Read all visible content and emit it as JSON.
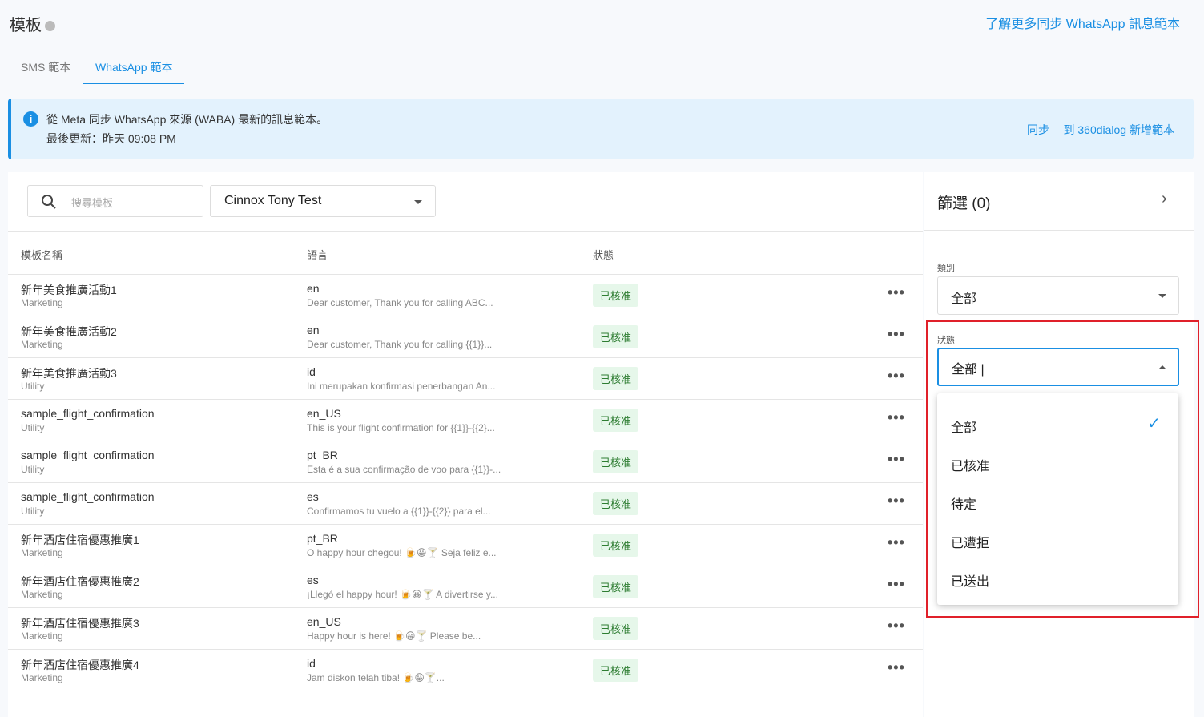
{
  "header": {
    "title": "模板",
    "learn_more": "了解更多同步 WhatsApp 訊息範本"
  },
  "tabs": [
    {
      "label": "SMS 範本"
    },
    {
      "label": "WhatsApp 範本"
    }
  ],
  "banner": {
    "line1": "從 Meta 同步 WhatsApp 來源 (WABA) 最新的訊息範本。",
    "line2": "最後更新：昨天 09:08 PM",
    "sync": "同步",
    "add": "到 360dialog 新增範本"
  },
  "search": {
    "placeholder": "搜尋模板"
  },
  "account_select": {
    "value": "Cinnox Tony Test"
  },
  "table": {
    "headers": [
      "模板名稱",
      "語言",
      "狀態"
    ],
    "rows": [
      {
        "name": "新年美食推廣活動1",
        "category": "Marketing",
        "lang": "en",
        "preview": "Dear customer, Thank you for calling ABC...",
        "status": "已核准"
      },
      {
        "name": "新年美食推廣活動2",
        "category": "Marketing",
        "lang": "en",
        "preview": "Dear customer, Thank you for calling {{1}}...",
        "status": "已核准"
      },
      {
        "name": "新年美食推廣活動3",
        "category": "Utility",
        "lang": "id",
        "preview": "Ini merupakan konfirmasi penerbangan An...",
        "status": "已核准"
      },
      {
        "name": "sample_flight_confirmation",
        "category": "Utility",
        "lang": "en_US",
        "preview": "This is your flight confirmation for {{1}}-{{2}...",
        "status": "已核准"
      },
      {
        "name": "sample_flight_confirmation",
        "category": "Utility",
        "lang": "pt_BR",
        "preview": "Esta é a sua confirmação de voo para {{1}}-...",
        "status": "已核准"
      },
      {
        "name": "sample_flight_confirmation",
        "category": "Utility",
        "lang": "es",
        "preview": "Confirmamos tu vuelo a {{1}}-{{2}} para el...",
        "status": "已核准"
      },
      {
        "name": "新年酒店住宿優惠推廣1",
        "category": "Marketing",
        "lang": "pt_BR",
        "preview": "O happy hour chegou! 🍺😀🍸 Seja feliz e...",
        "status": "已核准"
      },
      {
        "name": "新年酒店住宿優惠推廣2",
        "category": "Marketing",
        "lang": "es",
        "preview": "¡Llegó el happy hour! 🍺😀🍸 A divertirse y...",
        "status": "已核准"
      },
      {
        "name": "新年酒店住宿優惠推廣3",
        "category": "Marketing",
        "lang": "en_US",
        "preview": "Happy hour is here! 🍺😀🍸 Please be...",
        "status": "已核准"
      },
      {
        "name": "新年酒店住宿優惠推廣4",
        "category": "Marketing",
        "lang": "id",
        "preview": "Jam diskon telah tiba! 🍺😀🍸...",
        "status": "已核准"
      }
    ]
  },
  "filter": {
    "title": "篩選 (0)",
    "category_label": "類別",
    "category_value": "全部",
    "status_label": "狀態",
    "status_value": "全部 |",
    "options": [
      "全部",
      "已核准",
      "待定",
      "已遭拒",
      "已送出"
    ]
  }
}
